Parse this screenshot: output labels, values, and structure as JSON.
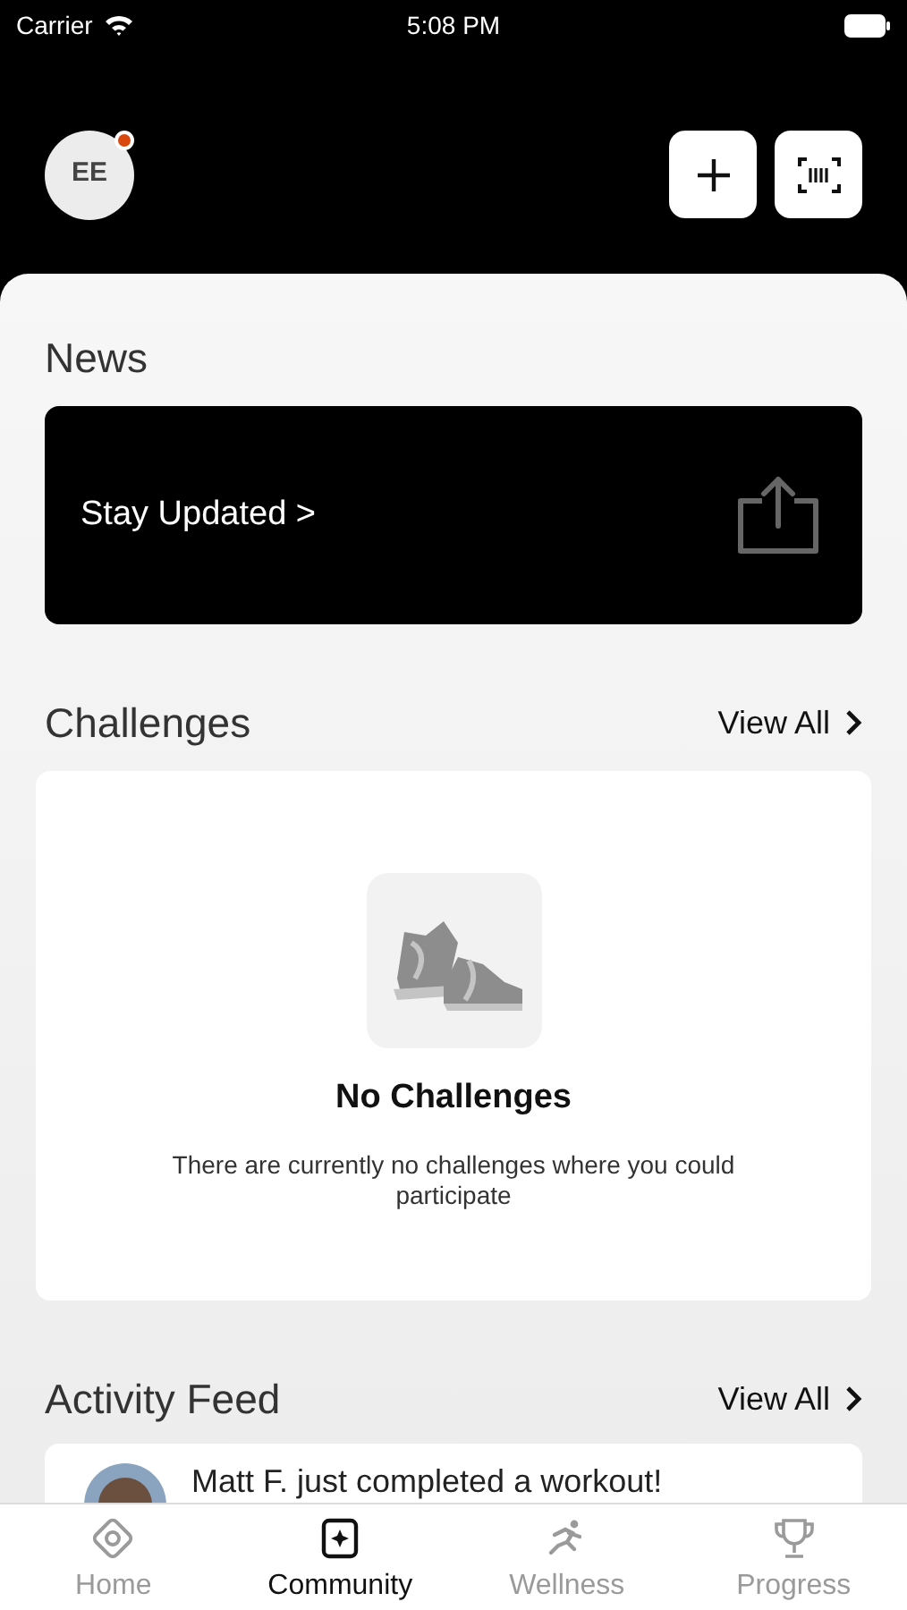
{
  "status_bar": {
    "carrier": "Carrier",
    "time": "5:08 PM"
  },
  "header": {
    "avatar_initials": "EE",
    "notification_dot": true
  },
  "news": {
    "title": "News",
    "banner": "Stay Updated >"
  },
  "challenges": {
    "title": "Challenges",
    "view_all": "View All",
    "empty_title": "No Challenges",
    "empty_text": "There are currently no challenges where you could participate"
  },
  "activity_feed": {
    "title": "Activity Feed",
    "view_all": "View All",
    "items": [
      {
        "text": "Matt F. just completed a workout!"
      }
    ]
  },
  "tabs": [
    {
      "label": "Home",
      "selected": false,
      "kind": "home"
    },
    {
      "label": "Community",
      "selected": true,
      "kind": "community"
    },
    {
      "label": "Wellness",
      "selected": false,
      "kind": "wellness"
    },
    {
      "label": "Progress",
      "selected": false,
      "kind": "progress"
    }
  ]
}
